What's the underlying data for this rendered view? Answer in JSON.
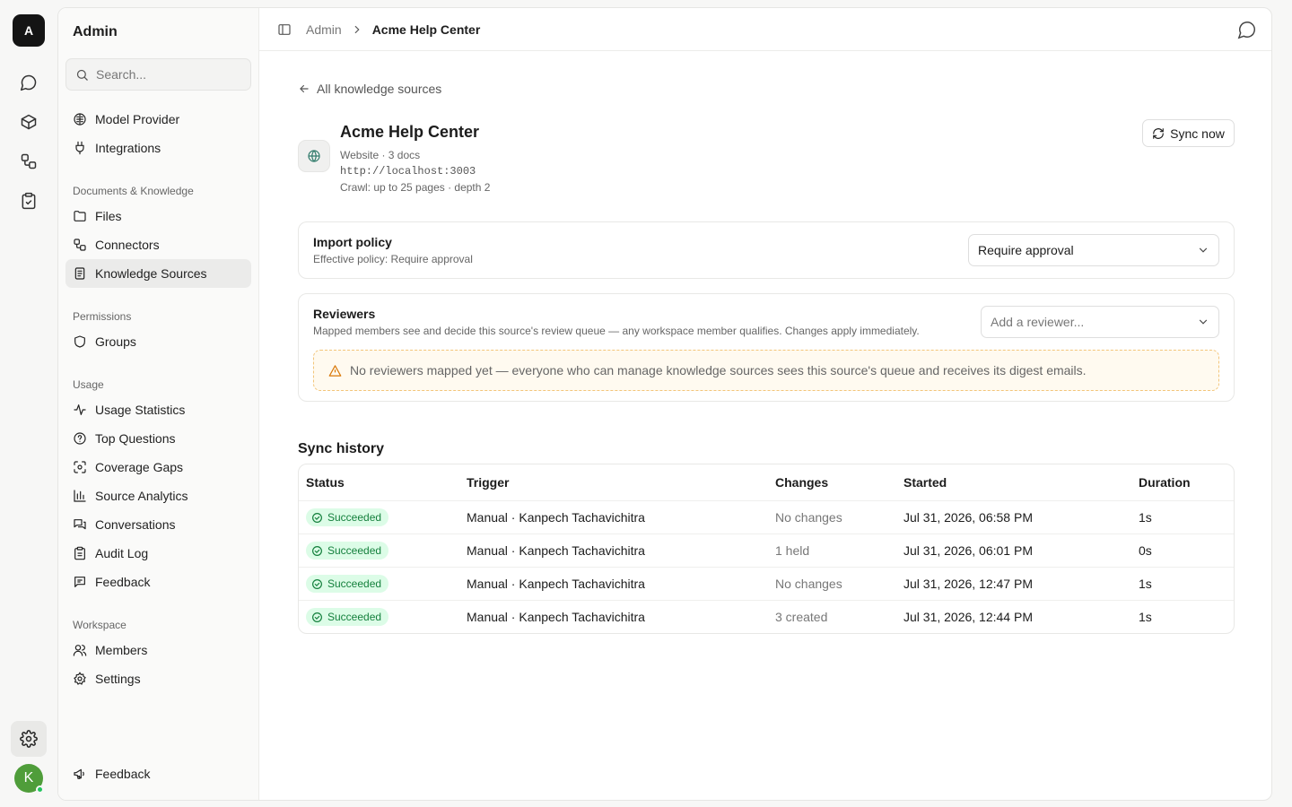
{
  "rail": {
    "logo_letter": "A",
    "icons": [
      "chat-icon",
      "box-icon",
      "workflow-icon",
      "clipboard-check-icon"
    ],
    "settings_icon": "gear-icon",
    "avatar_letter": "K"
  },
  "sidebar": {
    "title": "Admin",
    "search_placeholder": "Search...",
    "items_top": [
      {
        "label": "Model Provider",
        "icon": "brain-icon"
      },
      {
        "label": "Integrations",
        "icon": "plug-icon"
      }
    ],
    "sections": [
      {
        "label": "Documents & Knowledge",
        "items": [
          {
            "label": "Files",
            "icon": "folder-icon"
          },
          {
            "label": "Connectors",
            "icon": "connector-icon"
          },
          {
            "label": "Knowledge Sources",
            "icon": "book-icon",
            "active": true
          }
        ]
      },
      {
        "label": "Permissions",
        "items": [
          {
            "label": "Groups",
            "icon": "shield-icon"
          }
        ]
      },
      {
        "label": "Usage",
        "items": [
          {
            "label": "Usage Statistics",
            "icon": "activity-icon"
          },
          {
            "label": "Top Questions",
            "icon": "question-icon"
          },
          {
            "label": "Coverage Gaps",
            "icon": "scan-icon"
          },
          {
            "label": "Source Analytics",
            "icon": "bar-chart-icon"
          },
          {
            "label": "Conversations",
            "icon": "messages-icon"
          },
          {
            "label": "Audit Log",
            "icon": "clipboard-icon"
          },
          {
            "label": "Feedback",
            "icon": "message-square-icon"
          }
        ]
      },
      {
        "label": "Workspace",
        "items": [
          {
            "label": "Members",
            "icon": "users-icon"
          },
          {
            "label": "Settings",
            "icon": "gear-icon"
          }
        ]
      }
    ],
    "footer_feedback": "Feedback"
  },
  "topbar": {
    "crumb_root": "Admin",
    "crumb_current": "Acme Help Center"
  },
  "source": {
    "back_label": "All knowledge sources",
    "title": "Acme Help Center",
    "meta_type": "Website · 3 docs",
    "url": "http://localhost:3003",
    "crawl": "Crawl: up to 25 pages · depth 2",
    "sync_label": "Sync now"
  },
  "import_policy": {
    "title": "Import policy",
    "subtitle": "Effective policy: Require approval",
    "selected": "Require approval"
  },
  "reviewers": {
    "title": "Reviewers",
    "subtitle": "Mapped members see and decide this source's review queue — any workspace member qualifies. Changes apply immediately.",
    "placeholder": "Add a reviewer...",
    "warning": "No reviewers mapped yet — everyone who can manage knowledge sources sees this source's queue and receives its digest emails."
  },
  "sync_history": {
    "title": "Sync history",
    "columns": [
      "Status",
      "Trigger",
      "Changes",
      "Started",
      "Duration"
    ],
    "rows": [
      {
        "status": "Succeeded",
        "trigger": "Manual · Kanpech Tachavichitra",
        "changes": "No changes",
        "started": "Jul 31, 2026, 06:58 PM",
        "duration": "1s"
      },
      {
        "status": "Succeeded",
        "trigger": "Manual · Kanpech Tachavichitra",
        "changes": "1 held",
        "started": "Jul 31, 2026, 06:01 PM",
        "duration": "0s"
      },
      {
        "status": "Succeeded",
        "trigger": "Manual · Kanpech Tachavichitra",
        "changes": "No changes",
        "started": "Jul 31, 2026, 12:47 PM",
        "duration": "1s"
      },
      {
        "status": "Succeeded",
        "trigger": "Manual · Kanpech Tachavichitra",
        "changes": "3 created",
        "started": "Jul 31, 2026, 12:44 PM",
        "duration": "1s"
      }
    ]
  }
}
